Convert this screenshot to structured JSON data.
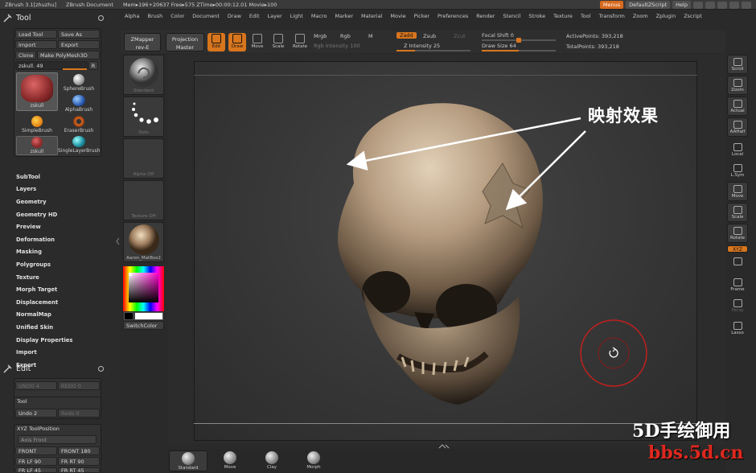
{
  "titlebar": {
    "app": "ZBrush  3.1[zhuzhu]",
    "doc": "ZBrush Document",
    "stats": "Mem▸196+20637 Free▸575 ZTime▸00:00:12.01 Movie▸100",
    "menus_label": "Menus",
    "script_label": "DefaultZScript",
    "help_label": "Help"
  },
  "menubar": [
    "Alpha",
    "Brush",
    "Color",
    "Document",
    "Draw",
    "Edit",
    "Layer",
    "Light",
    "Macro",
    "Marker",
    "Material",
    "Movie",
    "Picker",
    "Preferences",
    "Render",
    "Stencil",
    "Stroke",
    "Texture",
    "Tool",
    "Transform",
    "Zoom",
    "Zplugin",
    "Zscript"
  ],
  "tool_panel": {
    "title": "Tool",
    "load_tool": "Load Tool",
    "save_as": "Save As",
    "import": "Import",
    "export": "Export",
    "clone": "Clone",
    "make_polymesh": "Make PolyMesh3D",
    "current_tool": "zskull. 49",
    "r_label": "R",
    "brushes": [
      {
        "label": "zskull"
      },
      {
        "label": "SphereBrush"
      },
      {
        "label": "AlphaBrush"
      },
      {
        "label": "SimpleBrush"
      },
      {
        "label": "EraserBrush"
      },
      {
        "label": "zskull"
      },
      {
        "label": "SingleLayerBrush"
      }
    ],
    "menu_items": [
      "SubTool",
      "Layers",
      "Geometry",
      "Geometry HD",
      "Preview",
      "Deformation",
      "Masking",
      "Polygroups",
      "Texture",
      "Morph Target",
      "Displacement",
      "NormalMap",
      "Unified Skin",
      "Display Properties",
      "Import",
      "Export"
    ]
  },
  "edit_panel": {
    "title": "Edit",
    "undo_dim": "UNDO 4",
    "redo_dim": "REDO 0",
    "tool_label": "Tool",
    "undo": "Undo 2",
    "redo": "Redo 0"
  },
  "xyz_panel": {
    "title": "XYZ ToolPosition",
    "axis_front": "Axis Front",
    "front": "FRONT",
    "front180": "FRONT 180",
    "fr_lf_90": "FR LF 90",
    "fr_rt_90": "FR RT 90",
    "fr_lf_45": "FR LF 45",
    "fr_rt_45": "FR RT 45"
  },
  "brushstrip": {
    "standard": "Standard",
    "dots": "Dots",
    "alpha_off": "Alpha  Off",
    "texture_off": "Texture  Off",
    "material": "Aaron_MatBox2",
    "switch_color": "SwitchColor"
  },
  "shelf": {
    "zmapper": "ZMapper",
    "zmapper_sub": "rev-E",
    "projection": "Projection",
    "projection_sub": "Master",
    "edit": "Edit",
    "draw": "Draw",
    "move": "Move",
    "scale": "Scale",
    "rotate": "Rotate",
    "mrgb": "Mrgb",
    "rgb": "Rgb",
    "m": "M",
    "rgb_intensity": "Rgb Intensity 100",
    "zadd": "Zadd",
    "zsub": "Zsub",
    "zcut": "Zcut",
    "z_intensity": "Z Intensity 25",
    "z_intensity_value": 25,
    "focal_shift": "Focal Shift 0",
    "draw_size": "Draw Size 64",
    "draw_size_value": 64,
    "active_points": "ActivePoints: 393,218",
    "total_points": "TotalPoints: 393,218"
  },
  "right_tools": [
    "Scroll",
    "Zoom",
    "Actual",
    "AAHalf",
    "Local",
    "L.Sym",
    "Move",
    "Scale",
    "Rotate",
    "XYZ",
    "",
    "Frame",
    "Persp",
    "Lasso"
  ],
  "annotation": "映射效果",
  "bottom_shelf": [
    "Standard",
    "Move",
    "Clay",
    "Morph"
  ],
  "watermark": {
    "line1": "5D手绘御用",
    "line2": "bbs.5d.cn"
  },
  "colors": {
    "accent": "#d8761e",
    "panel": "#2b2b2b",
    "brush_circle": "#c0201e"
  }
}
